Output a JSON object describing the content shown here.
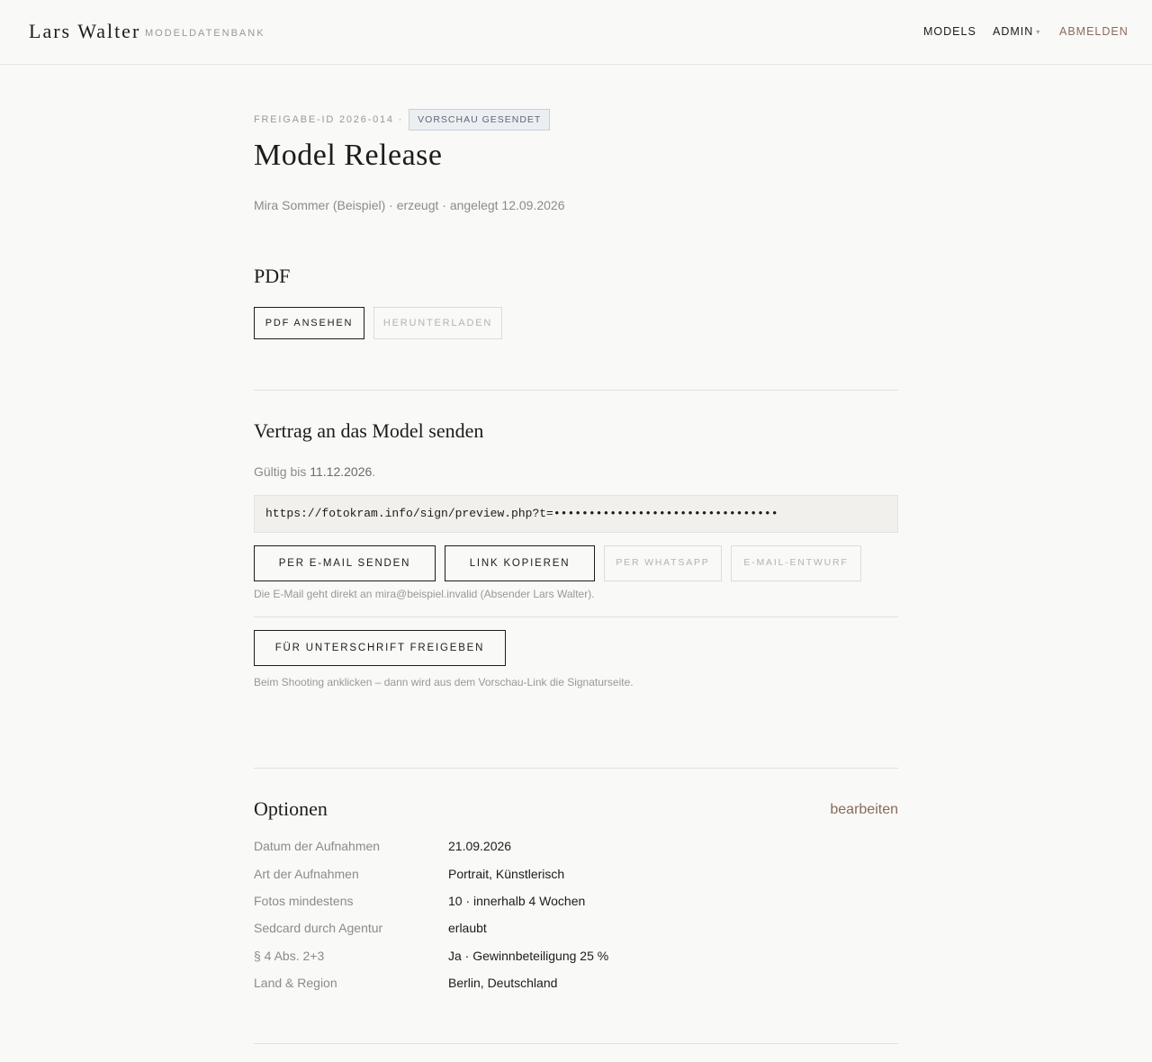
{
  "header": {
    "brand": "Lars Walter",
    "brand_sub": "MODELDATENBANK",
    "nav": {
      "models": "MODELS",
      "admin": "ADMIN",
      "admin_caret": "▾",
      "logout": "ABMELDEN"
    }
  },
  "release": {
    "id_label": "FREIGABE-ID 2026-014 ·",
    "status_badge": "VORSCHAU GESENDET",
    "title": "Model Release",
    "meta": "Mira Sommer (Beispiel) · erzeugt · angelegt 12.09.2026"
  },
  "pdf": {
    "heading": "PDF",
    "view_label": "PDF ANSEHEN",
    "download_label": "HERUNTERLADEN"
  },
  "send": {
    "heading": "Vertrag an das Model senden",
    "valid_prefix": "Gültig bis ",
    "valid_date": "11.12.2026",
    "valid_suffix": ".",
    "link": "https://fotokram.info/sign/preview.php?t=••••••••••••••••••••••••••••••••",
    "email_label": "PER E-MAIL SENDEN",
    "copy_label": "LINK KOPIEREN",
    "whatsapp_label": "PER WHATSAPP",
    "draft_label": "E-MAIL-ENTWURF",
    "email_hint": "Die E-Mail geht direkt an mira@beispiel.invalid (Absender Lars Walter).",
    "release_label": "FÜR UNTERSCHRIFT FREIGEBEN",
    "release_hint": "Beim Shooting anklicken – dann wird aus dem Vorschau-Link die Signaturseite."
  },
  "options": {
    "heading": "Optionen",
    "edit_label": "bearbeiten",
    "rows": [
      {
        "key": "Datum der Aufnahmen",
        "value": "21.09.2026"
      },
      {
        "key": "Art der Aufnahmen",
        "value": "Portrait, Künstlerisch"
      },
      {
        "key": "Fotos mindestens",
        "value": "10 · innerhalb 4 Wochen"
      },
      {
        "key": "Sedcard durch Agentur",
        "value": "erlaubt"
      },
      {
        "key": "§ 4 Abs. 2+3",
        "value": "Ja · Gewinnbeteiligung 25 %"
      },
      {
        "key": "Land & Region",
        "value": "Berlin, Deutschland"
      }
    ]
  },
  "colors": {
    "accent": "#8a6a5c",
    "badge_bg": "#eceff2",
    "badge_text": "#5c6876"
  }
}
